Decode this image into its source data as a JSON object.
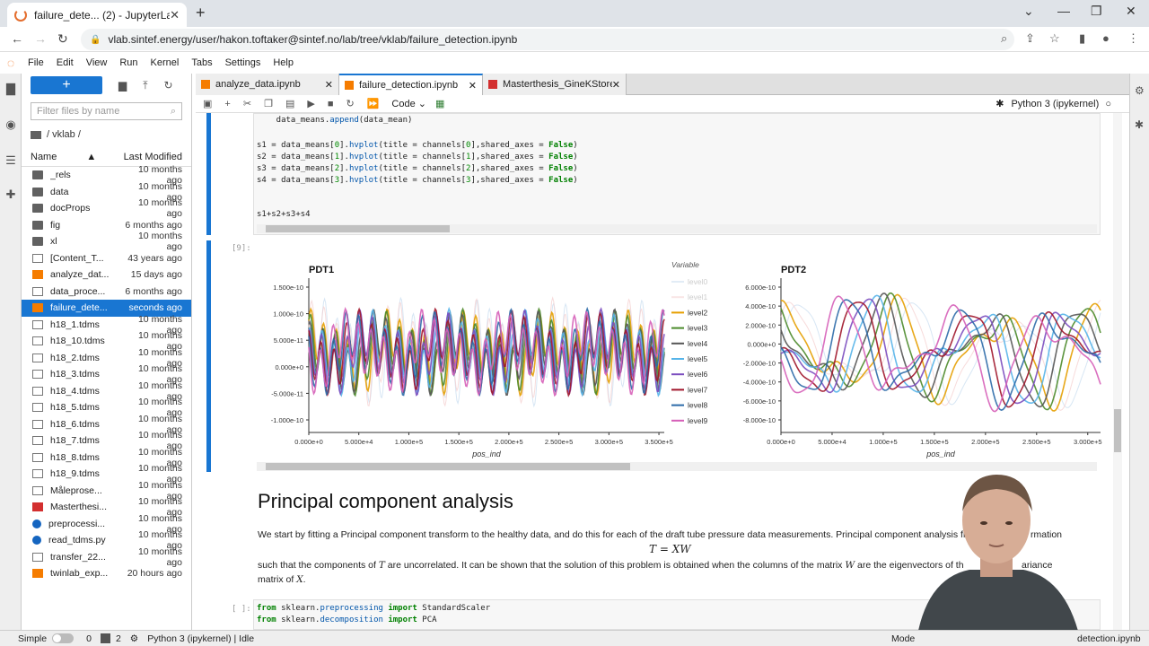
{
  "browser": {
    "tab_title": "failure_dete... (2) - JupyterLab",
    "url": "vlab.sintef.energy/user/hakon.toftaker@sintef.no/lab/tree/vklab/failure_detection.ipynb"
  },
  "menu": [
    "File",
    "Edit",
    "View",
    "Run",
    "Kernel",
    "Tabs",
    "Settings",
    "Help"
  ],
  "filebrowser": {
    "filter_placeholder": "Filter files by name",
    "path": "/ vklab /",
    "col_name": "Name",
    "col_modified": "Last Modified",
    "files": [
      {
        "name": "_rels",
        "modified": "10 months ago",
        "type": "folder"
      },
      {
        "name": "data",
        "modified": "10 months ago",
        "type": "folder"
      },
      {
        "name": "docProps",
        "modified": "10 months ago",
        "type": "folder"
      },
      {
        "name": "fig",
        "modified": "6 months ago",
        "type": "folder"
      },
      {
        "name": "xl",
        "modified": "10 months ago",
        "type": "folder"
      },
      {
        "name": "[Content_T...",
        "modified": "43 years ago",
        "type": "file"
      },
      {
        "name": "analyze_dat...",
        "modified": "15 days ago",
        "type": "notebook"
      },
      {
        "name": "data_proce...",
        "modified": "6 months ago",
        "type": "file"
      },
      {
        "name": "failure_dete...",
        "modified": "seconds ago",
        "type": "notebook",
        "selected": true
      },
      {
        "name": "h18_1.tdms",
        "modified": "10 months ago",
        "type": "file"
      },
      {
        "name": "h18_10.tdms",
        "modified": "10 months ago",
        "type": "file"
      },
      {
        "name": "h18_2.tdms",
        "modified": "10 months ago",
        "type": "file"
      },
      {
        "name": "h18_3.tdms",
        "modified": "10 months ago",
        "type": "file"
      },
      {
        "name": "h18_4.tdms",
        "modified": "10 months ago",
        "type": "file"
      },
      {
        "name": "h18_5.tdms",
        "modified": "10 months ago",
        "type": "file"
      },
      {
        "name": "h18_6.tdms",
        "modified": "10 months ago",
        "type": "file"
      },
      {
        "name": "h18_7.tdms",
        "modified": "10 months ago",
        "type": "file"
      },
      {
        "name": "h18_8.tdms",
        "modified": "10 months ago",
        "type": "file"
      },
      {
        "name": "h18_9.tdms",
        "modified": "10 months ago",
        "type": "file"
      },
      {
        "name": "Måleprose...",
        "modified": "10 months ago",
        "type": "file"
      },
      {
        "name": "Masterthesi...",
        "modified": "10 months ago",
        "type": "pdf"
      },
      {
        "name": "preprocessi...",
        "modified": "10 months ago",
        "type": "python"
      },
      {
        "name": "read_tdms.py",
        "modified": "10 months ago",
        "type": "python"
      },
      {
        "name": "transfer_22...",
        "modified": "10 months ago",
        "type": "file"
      },
      {
        "name": "twinlab_exp...",
        "modified": "20 hours ago",
        "type": "notebook"
      }
    ]
  },
  "doc_tabs": [
    "analyze_data.ipynb",
    "failure_detection.ipynb",
    "Masterthesis_GineKStoren.pc"
  ],
  "toolbar": {
    "cell_type": "Code",
    "kernel": "Python 3 (ipykernel)"
  },
  "code_top": [
    "    data_means.append(data_mean)",
    "",
    "s1 = data_means[0].hvplot(title = channels[0],shared_axes = False)",
    "s2 = data_means[1].hvplot(title = channels[1],shared_axes = False)",
    "s3 = data_means[2].hvplot(title = channels[2],shared_axes = False)",
    "s4 = data_means[3].hvplot(title = channels[3],shared_axes = False)",
    "",
    "",
    "s1+s2+s3+s4"
  ],
  "out_prompt": "[9]:",
  "code_prompt": "[ ]:",
  "chart_data": [
    {
      "type": "line",
      "title": "PDT1",
      "xlabel": "pos_ind",
      "ylabel": "",
      "xticks": [
        "0.000e+0",
        "5.000e+4",
        "1.000e+5",
        "1.500e+5",
        "2.000e+5",
        "2.500e+5",
        "3.000e+5",
        "3.500e+5"
      ],
      "yticks": [
        "1.500e-10",
        "1.000e-10",
        "5.000e-11",
        "0.000e+0",
        "-5.000e-11",
        "-1.000e-10"
      ],
      "xlim": [
        0,
        360000
      ],
      "ylim": [
        -1.3e-10,
        1.6e-10
      ]
    },
    {
      "type": "line",
      "title": "PDT2",
      "xlabel": "pos_ind",
      "ylabel": "",
      "xticks": [
        "0.000e+0",
        "5.000e+4",
        "1.000e+5",
        "1.500e+5",
        "2.000e+5",
        "2.500e+5",
        "3.000e+5"
      ],
      "yticks": [
        "6.000e-10",
        "4.000e-10",
        "2.000e-10",
        "0.000e+0",
        "-2.000e-10",
        "-4.000e-10",
        "-6.000e-10",
        "-8.000e-10"
      ],
      "xlim": [
        0,
        320000
      ],
      "ylim": [
        -8.5e-10,
        6.5e-10
      ]
    }
  ],
  "legend": {
    "title": "Variable",
    "items": [
      {
        "name": "level0",
        "color": "#c6dbef",
        "muted": true
      },
      {
        "name": "level1",
        "color": "#f4cccc",
        "muted": true
      },
      {
        "name": "level2",
        "color": "#e69f00"
      },
      {
        "name": "level3",
        "color": "#4b8a2a"
      },
      {
        "name": "level4",
        "color": "#555555"
      },
      {
        "name": "level5",
        "color": "#56b4e9"
      },
      {
        "name": "level6",
        "color": "#7b4dbf"
      },
      {
        "name": "level7",
        "color": "#a0152a"
      },
      {
        "name": "level8",
        "color": "#2c6aa8"
      },
      {
        "name": "level9",
        "color": "#d65fb8"
      }
    ]
  },
  "markdown": {
    "heading": "Principal component analysis",
    "p1": "We start by fitting a Principal component transform to the healthy data, and do this for each of the draft tube pressure data measurements. Principal component analysis fi",
    "p1b": "rmation",
    "formula": "T = XW",
    "p2a": "such that the components of",
    "p2var": "T",
    "p2b": "are uncorrelated. It can be shown that the solution of this problem is obtained when the columns of the matrix",
    "p2var2": "W",
    "p2c": "are the eigenvectors of th",
    "p2d": "ariance",
    "p3a": "matrix of",
    "p3var": "X",
    "p3b": "."
  },
  "code_bottom": [
    "from sklearn.preprocessing import StandardScaler",
    "from sklearn.decomposition import PCA"
  ],
  "status": {
    "mode": "Simple",
    "count0": "0",
    "count2": "2",
    "kernel_status": "Python 3 (ipykernel) | Idle",
    "right_mode": "Mode",
    "right_file": "detection.ipynb"
  }
}
